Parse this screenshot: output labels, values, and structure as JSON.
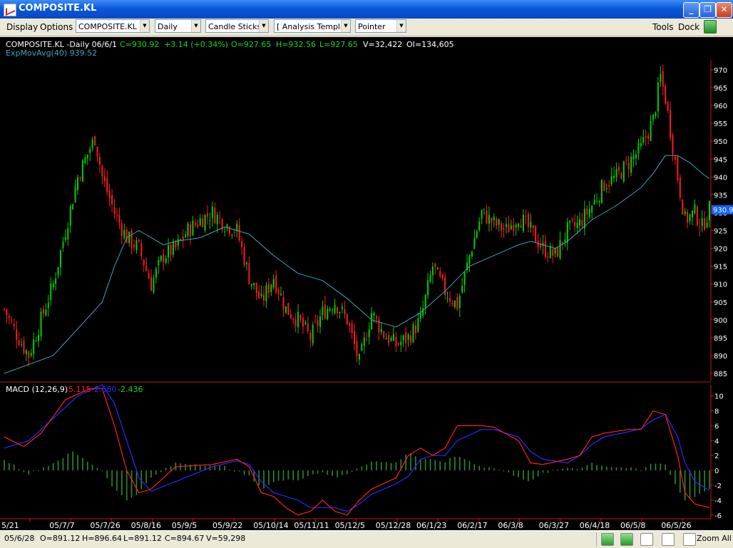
{
  "window": {
    "title": "COMPOSITE.KL",
    "min": "_",
    "max": "❐",
    "close": "✕"
  },
  "menus": {
    "display": "Display",
    "options": "Options",
    "tools": "Tools",
    "dock": "Dock"
  },
  "toolbar": {
    "symbol": "COMPOSITE.KL",
    "period": "Daily",
    "chart_style": "Candle Sticks",
    "template": "[ Analysis Templa",
    "cursor": "Pointer"
  },
  "quote": {
    "symbol_period_date": "COMPOSITE.KL -Daily  06/6/1",
    "close": "C=930.92",
    "change": "+3.14 (+0.34%)",
    "open": "O=927.65",
    "high": "H=932.56",
    "low": "L=927.65",
    "volume": "V=32,422",
    "open_interest": "OI=134,605",
    "ema_label": "ExpMovAvg(40) 939.52"
  },
  "macd_legend": {
    "label": "MACD (12,26,9)",
    "macd": "-5.115",
    "signal": "-2.680",
    "hist": "-2.436"
  },
  "status": {
    "date": "05/6/28",
    "open": "O=891.12",
    "high": "H=896.64",
    "low": "L=891.12",
    "close": "C=894.67",
    "volume": "V=59,298",
    "zoom_all": "Zoom All"
  },
  "colors": {
    "up": "#00d000",
    "down": "#ff1a1a",
    "ema": "#3aa7b8",
    "macd": "#ff2020",
    "signal": "#2a2aff",
    "hist": "#2e8b2e",
    "price_tag": "#1060ff"
  },
  "chart_data": [
    {
      "type": "candlestick",
      "title": "COMPOSITE.KL -Daily",
      "price_axis": {
        "ticks": [
          885,
          890,
          895,
          900,
          905,
          910,
          915,
          920,
          925,
          930,
          935,
          940,
          945,
          950,
          955,
          960,
          965,
          970
        ],
        "range": [
          883,
          972
        ]
      },
      "last_price_label": "930.9",
      "x_tick_labels": [
        "5/21",
        "05/7/7",
        "05/7/26",
        "05/8/16",
        "05/9/5",
        "05/9/22",
        "05/10/14",
        "05/11/11",
        "05/12/5",
        "05/12/28",
        "06/1/23",
        "06/2/17",
        "06/3/8",
        "06/3/27",
        "06/4/18",
        "06/5/8",
        "06/5/26"
      ],
      "close_path": [
        [
          0,
          903
        ],
        [
          5,
          896
        ],
        [
          10,
          890
        ],
        [
          15,
          900
        ],
        [
          20,
          910
        ],
        [
          25,
          925
        ],
        [
          30,
          940
        ],
        [
          35,
          948
        ],
        [
          37,
          951
        ],
        [
          40,
          940
        ],
        [
          45,
          930
        ],
        [
          50,
          923
        ],
        [
          55,
          920
        ],
        [
          60,
          910
        ],
        [
          65,
          918
        ],
        [
          70,
          920
        ],
        [
          75,
          925
        ],
        [
          80,
          928
        ],
        [
          85,
          930
        ],
        [
          90,
          927
        ],
        [
          95,
          925
        ],
        [
          100,
          912
        ],
        [
          105,
          905
        ],
        [
          110,
          912
        ],
        [
          115,
          903
        ],
        [
          120,
          900
        ],
        [
          125,
          895
        ],
        [
          130,
          902
        ],
        [
          135,
          905
        ],
        [
          140,
          900
        ],
        [
          145,
          888
        ],
        [
          150,
          902
        ],
        [
          155,
          896
        ],
        [
          160,
          893
        ],
        [
          165,
          895
        ],
        [
          170,
          900
        ],
        [
          175,
          915
        ],
        [
          180,
          908
        ],
        [
          185,
          904
        ],
        [
          190,
          918
        ],
        [
          195,
          930
        ],
        [
          200,
          927
        ],
        [
          205,
          925
        ],
        [
          210,
          929
        ],
        [
          215,
          925
        ],
        [
          220,
          920
        ],
        [
          225,
          918
        ],
        [
          230,
          925
        ],
        [
          235,
          927
        ],
        [
          240,
          932
        ],
        [
          245,
          938
        ],
        [
          250,
          940
        ],
        [
          255,
          944
        ],
        [
          260,
          948
        ],
        [
          265,
          956
        ],
        [
          268,
          968
        ],
        [
          270,
          962
        ],
        [
          275,
          940
        ],
        [
          278,
          928
        ],
        [
          282,
          930
        ],
        [
          285,
          926
        ],
        [
          288,
          931
        ]
      ],
      "series": [
        {
          "name": "ExpMovAvg(40)",
          "values": [
            [
              0,
              885
            ],
            [
              20,
              890
            ],
            [
              40,
              905
            ],
            [
              45,
              915
            ],
            [
              50,
              923
            ],
            [
              55,
              925
            ],
            [
              60,
              923
            ],
            [
              65,
              921
            ],
            [
              70,
              922
            ],
            [
              80,
              923
            ],
            [
              90,
              926
            ],
            [
              95,
              925
            ],
            [
              100,
              924
            ],
            [
              110,
              918
            ],
            [
              120,
              913
            ],
            [
              130,
              911
            ],
            [
              140,
              906
            ],
            [
              150,
              900
            ],
            [
              160,
              898
            ],
            [
              170,
              902
            ],
            [
              180,
              908
            ],
            [
              190,
              915
            ],
            [
              200,
              918
            ],
            [
              210,
              921
            ],
            [
              215,
              922
            ],
            [
              220,
              921
            ],
            [
              225,
              920
            ],
            [
              230,
              922
            ],
            [
              240,
              928
            ],
            [
              250,
              932
            ],
            [
              260,
              937
            ],
            [
              265,
              941
            ],
            [
              270,
              946
            ],
            [
              275,
              946
            ],
            [
              280,
              944
            ],
            [
              285,
              941
            ],
            [
              288,
              939.5
            ]
          ]
        }
      ]
    },
    {
      "type": "line",
      "title": "MACD (12,26,9)",
      "ylim": [
        -6.5,
        11.5
      ],
      "y_ticks": [
        -6,
        -4,
        -2,
        0,
        2,
        4,
        6,
        8,
        10
      ],
      "series": [
        {
          "name": "MACD",
          "values": [
            [
              0,
              4.5
            ],
            [
              8,
              3.2
            ],
            [
              15,
              5
            ],
            [
              25,
              9.5
            ],
            [
              35,
              11
            ],
            [
              40,
              11
            ],
            [
              45,
              6
            ],
            [
              50,
              0
            ],
            [
              55,
              -3
            ],
            [
              60,
              -2.5
            ],
            [
              70,
              0.5
            ],
            [
              85,
              0.8
            ],
            [
              95,
              1.5
            ],
            [
              100,
              0.5
            ],
            [
              105,
              -3
            ],
            [
              110,
              -3.5
            ],
            [
              115,
              -5
            ],
            [
              120,
              -6
            ],
            [
              125,
              -5.5
            ],
            [
              130,
              -4
            ],
            [
              135,
              -5.5
            ],
            [
              140,
              -6
            ],
            [
              145,
              -4
            ],
            [
              150,
              -2.5
            ],
            [
              160,
              -1
            ],
            [
              165,
              2
            ],
            [
              170,
              3
            ],
            [
              175,
              2
            ],
            [
              180,
              3
            ],
            [
              185,
              6
            ],
            [
              195,
              6
            ],
            [
              200,
              5.8
            ],
            [
              210,
              4
            ],
            [
              215,
              1
            ],
            [
              220,
              0.8
            ],
            [
              230,
              1.5
            ],
            [
              235,
              2
            ],
            [
              240,
              4.5
            ],
            [
              245,
              5
            ],
            [
              255,
              5.5
            ],
            [
              260,
              5.5
            ],
            [
              265,
              8
            ],
            [
              270,
              7.5
            ],
            [
              275,
              2
            ],
            [
              278,
              -3
            ],
            [
              282,
              -4.5
            ],
            [
              288,
              -5
            ]
          ]
        },
        {
          "name": "Signal",
          "values": [
            [
              0,
              3
            ],
            [
              10,
              4
            ],
            [
              20,
              7
            ],
            [
              30,
              10
            ],
            [
              40,
              11.5
            ],
            [
              45,
              9
            ],
            [
              50,
              4
            ],
            [
              55,
              -1
            ],
            [
              60,
              -2.8
            ],
            [
              70,
              -1.5
            ],
            [
              85,
              0.5
            ],
            [
              95,
              1.3
            ],
            [
              100,
              0.8
            ],
            [
              105,
              -1.5
            ],
            [
              110,
              -3
            ],
            [
              120,
              -4
            ],
            [
              125,
              -5
            ],
            [
              130,
              -5
            ],
            [
              135,
              -5
            ],
            [
              140,
              -5.5
            ],
            [
              145,
              -4.5
            ],
            [
              150,
              -3.2
            ],
            [
              160,
              -1.8
            ],
            [
              165,
              -0.8
            ],
            [
              170,
              1.5
            ],
            [
              175,
              2
            ],
            [
              180,
              2
            ],
            [
              185,
              4
            ],
            [
              195,
              5.5
            ],
            [
              200,
              5.5
            ],
            [
              210,
              4.5
            ],
            [
              215,
              2.5
            ],
            [
              220,
              1.5
            ],
            [
              230,
              1
            ],
            [
              235,
              2
            ],
            [
              240,
              3.5
            ],
            [
              245,
              4.5
            ],
            [
              255,
              5.2
            ],
            [
              260,
              5.6
            ],
            [
              265,
              6.8
            ],
            [
              270,
              7.5
            ],
            [
              275,
              4.5
            ],
            [
              278,
              1
            ],
            [
              282,
              -1.5
            ],
            [
              288,
              -2.7
            ]
          ]
        },
        {
          "name": "Histogram",
          "values": [
            [
              0,
              1.5
            ],
            [
              10,
              -0.5
            ],
            [
              20,
              1
            ],
            [
              28,
              2.5
            ],
            [
              35,
              1
            ],
            [
              40,
              0
            ],
            [
              45,
              -2.5
            ],
            [
              50,
              -4
            ],
            [
              55,
              -3
            ],
            [
              60,
              -1
            ],
            [
              70,
              1
            ],
            [
              80,
              0.8
            ],
            [
              90,
              0.5
            ],
            [
              100,
              -0.8
            ],
            [
              105,
              -2.5
            ],
            [
              110,
              -1.5
            ],
            [
              120,
              -1.2
            ],
            [
              125,
              -0.6
            ],
            [
              130,
              -0.2
            ],
            [
              135,
              -1
            ],
            [
              140,
              -0.5
            ],
            [
              145,
              0.5
            ],
            [
              150,
              1.2
            ],
            [
              160,
              1
            ],
            [
              165,
              2.5
            ],
            [
              170,
              1.5
            ],
            [
              180,
              1.2
            ],
            [
              185,
              2
            ],
            [
              195,
              0.5
            ],
            [
              200,
              0.3
            ],
            [
              210,
              -0.8
            ],
            [
              215,
              -1.6
            ],
            [
              220,
              -0.4
            ],
            [
              230,
              0.4
            ],
            [
              235,
              0.3
            ],
            [
              240,
              1
            ],
            [
              245,
              0.6
            ],
            [
              255,
              0.3
            ],
            [
              260,
              0
            ],
            [
              265,
              1
            ],
            [
              270,
              0.8
            ],
            [
              275,
              -2.5
            ],
            [
              278,
              -4
            ],
            [
              282,
              -3.5
            ],
            [
              288,
              -2.4
            ]
          ]
        }
      ]
    }
  ]
}
